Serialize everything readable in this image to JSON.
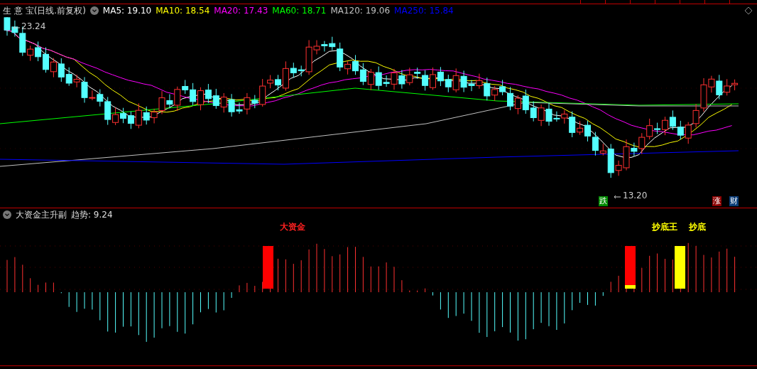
{
  "header": {
    "title": "生 意 宝(日线.前复权)",
    "indicators": [
      {
        "label": "MA5: 19.10",
        "color": "#ffffff"
      },
      {
        "label": "MA10: 18.54",
        "color": "#ffff00"
      },
      {
        "label": "MA20: 17.43",
        "color": "#ff00ff"
      },
      {
        "label": "MA60: 18.71",
        "color": "#00ff00"
      },
      {
        "label": "MA120: 19.06",
        "color": "#c0c0c0"
      },
      {
        "label": "MA250: 15.84",
        "color": "#0000ff"
      }
    ]
  },
  "price_chart": {
    "high_label": "23.24",
    "low_label": "13.20",
    "badges": [
      {
        "text": "跌",
        "color": "#008a00"
      },
      {
        "text": "涨",
        "color": "#8b0000"
      },
      {
        "text": "财",
        "color": "#0b3d78"
      }
    ]
  },
  "indicator_panel": {
    "title": "大资金主升副",
    "trend": "趋势: 9.24",
    "signals": [
      {
        "text": "大资金",
        "color": "#ff2020"
      },
      {
        "text": "抄底王",
        "color": "#ffff00"
      },
      {
        "text": "抄底",
        "color": "#ffff00"
      }
    ]
  }
}
